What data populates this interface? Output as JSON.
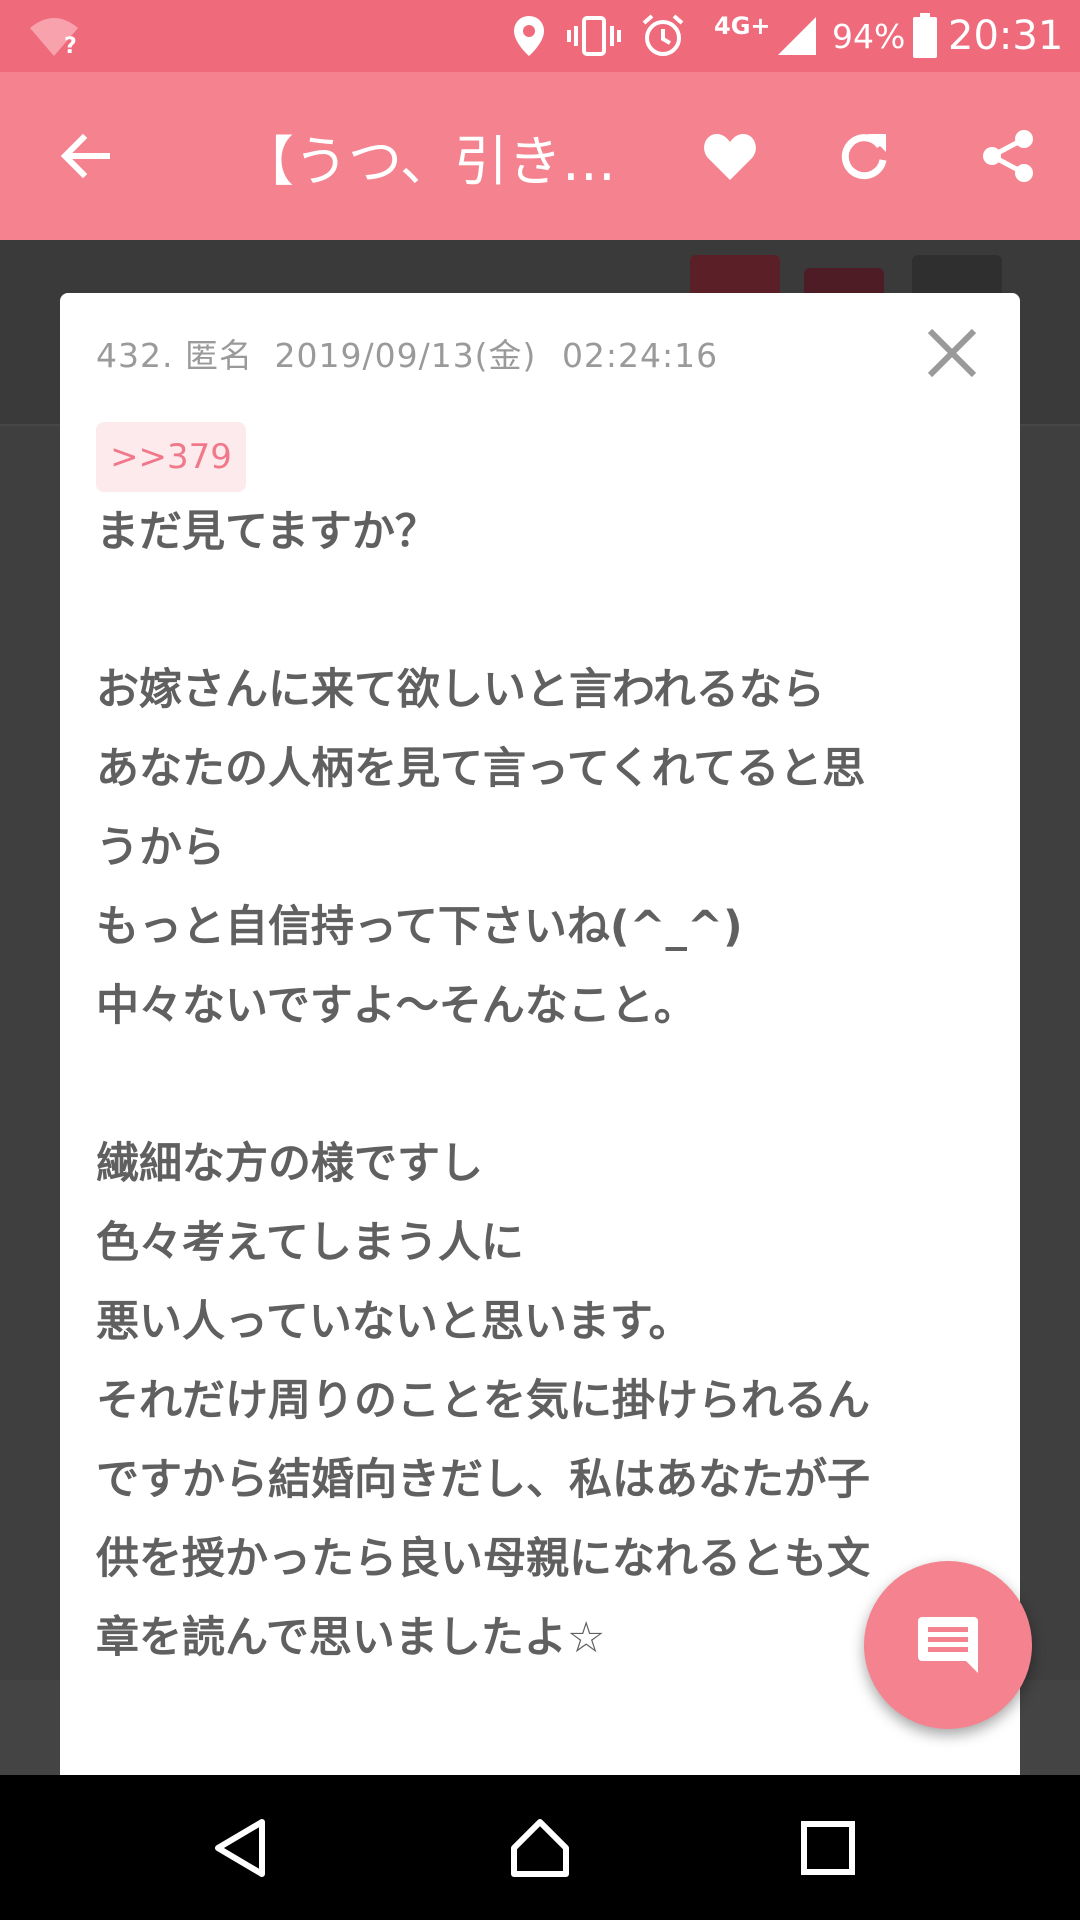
{
  "status_bar": {
    "wifi_badge": "?",
    "network": "4G+",
    "battery": "94%",
    "time": "20:31",
    "icons": [
      "wifi-icon",
      "location-icon",
      "vibrate-icon",
      "alarm-icon",
      "signal-icon",
      "battery-icon"
    ]
  },
  "app_bar": {
    "title": "【うつ、引き…",
    "icons": [
      "back-arrow-icon",
      "heart-icon",
      "refresh-icon",
      "share-icon"
    ]
  },
  "comment": {
    "number": "432.",
    "author": "匿名",
    "date": "2019/09/13(金)",
    "time": "02:24:16",
    "reply_anchor": ">>379",
    "lines": [
      "まだ見てますか？",
      "",
      "お嫁さんに来て欲しいと言われるなら",
      "あなたの人柄を見て言ってくれてると思",
      "うから",
      "もっと自信持って下さいね(^_^)",
      "中々ないですよ〜そんなこと。",
      "",
      "繊細な方の様ですし",
      "色々考えてしまう人に",
      "悪い人っていないと思います。",
      "それだけ周りのことを気に掛けられるん",
      "ですから結婚向きだし、私はあなたが子",
      "供を授かったら良い母親になれるとも文",
      "章を読んで思いましたよ☆"
    ]
  },
  "colors": {
    "status_bar": "#ef6b7c",
    "app_bar": "#f4838f",
    "anchor_bg": "#fdeaed",
    "anchor_text": "#f1788a",
    "body_text": "#606060",
    "meta_text": "#9a9a9a"
  },
  "fab": {
    "icon": "comment-icon"
  },
  "nav_bar": {
    "icons": [
      "back-triangle-icon",
      "home-icon",
      "recents-icon"
    ]
  }
}
